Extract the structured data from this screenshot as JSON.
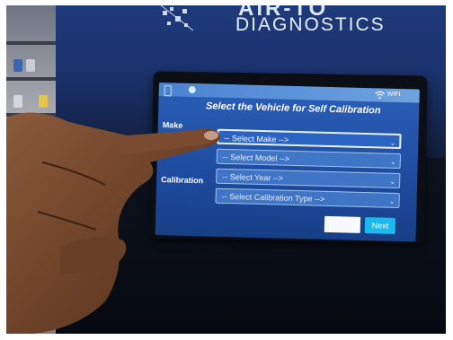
{
  "brand": {
    "name_partial": "AIR-TO",
    "tagline": "DIAGNOSTICS"
  },
  "status_bar": {
    "wifi_label": "WIFI",
    "icons": [
      "app-icon",
      "circle-icon",
      "wifi-icon"
    ]
  },
  "screen": {
    "title": "Select the Vehicle for Self Calibration",
    "rows": [
      {
        "label": "Make",
        "placeholder": "-- Select Make -->"
      },
      {
        "label": "",
        "placeholder": "-- Select Model -->"
      },
      {
        "label": "",
        "placeholder": "-- Select Year -->"
      },
      {
        "label": "Calibration",
        "placeholder": "-- Select Calibration Type -->"
      }
    ],
    "next_label": "Next"
  },
  "colors": {
    "cabinet": "#1b3470",
    "screen": "#1e4b9e",
    "next_button": "#1ab9ee"
  }
}
